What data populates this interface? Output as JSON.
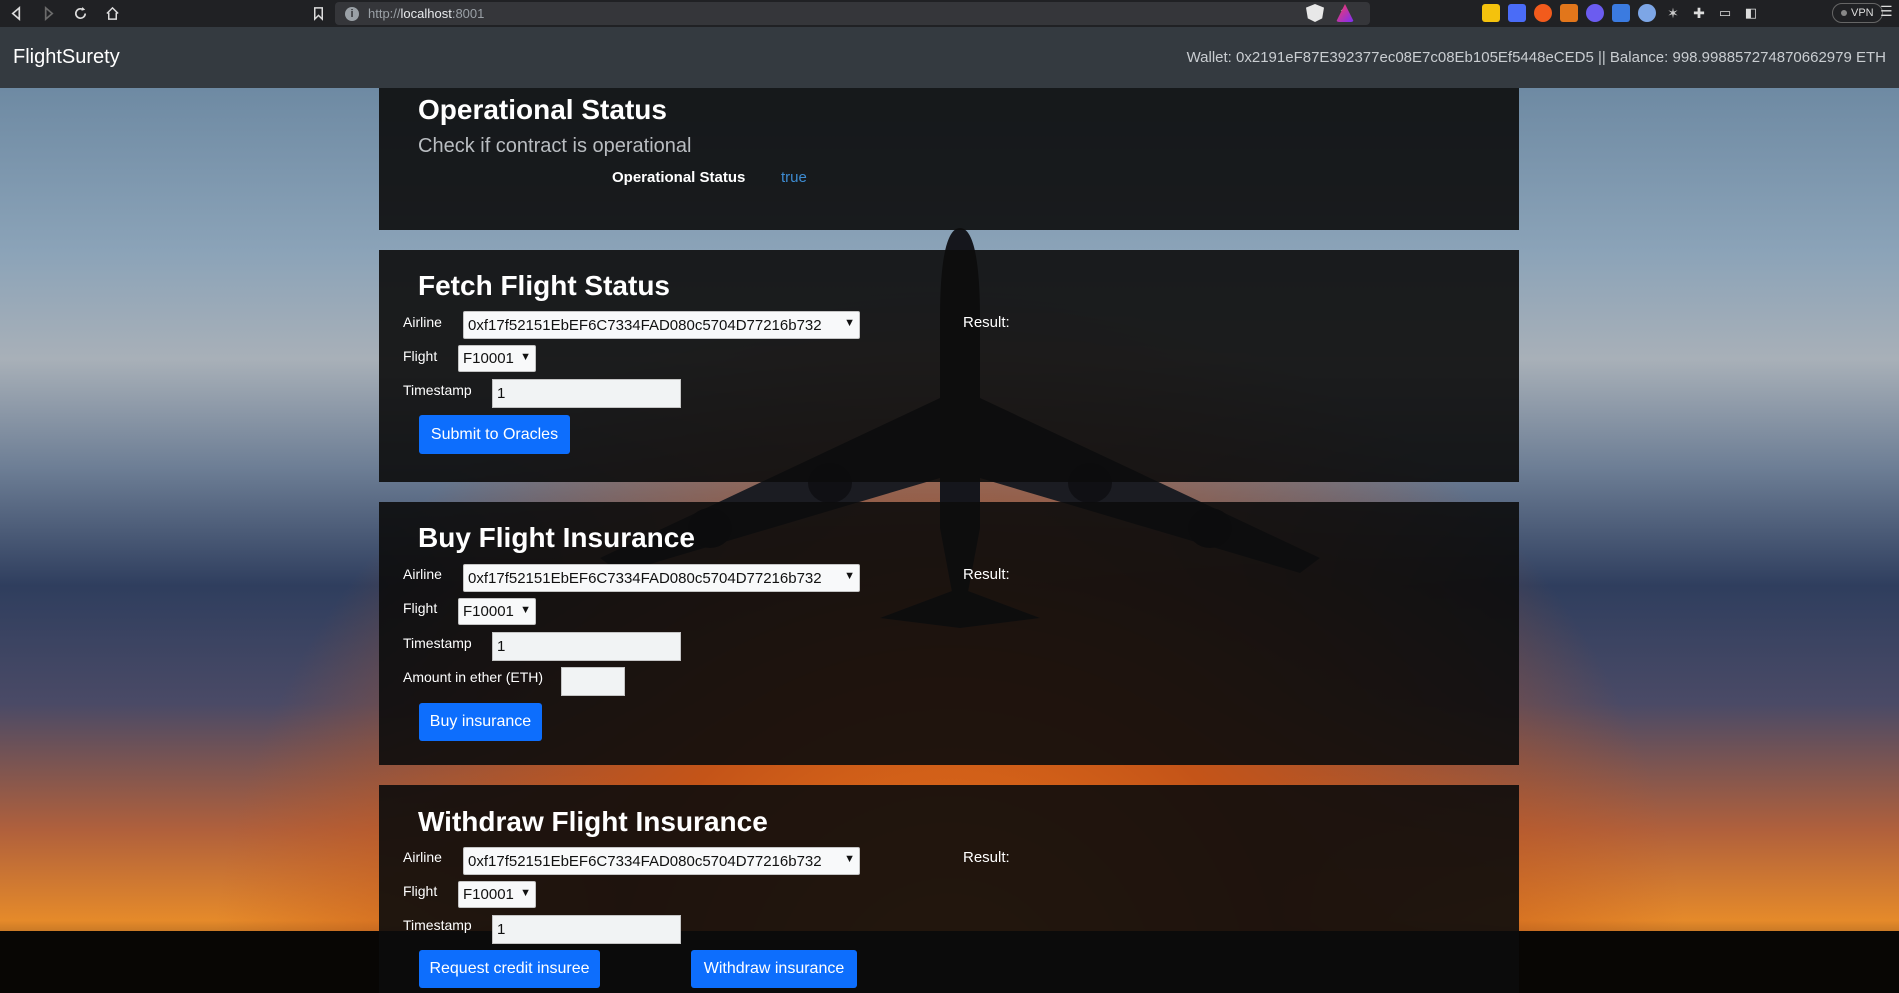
{
  "browser": {
    "url_scheme": "http://",
    "url_host": "localhost",
    "url_port": ":8001",
    "vpn_label": "VPN"
  },
  "navbar": {
    "brand": "FlightSurety",
    "wallet_text": "Wallet: 0x2191eF87E392377ec08E7c08Eb105Ef5448eCED5 || Balance: 998.998857274870662979 ETH"
  },
  "operational": {
    "title": "Operational Status",
    "subtitle": "Check if contract is operational",
    "status_label": "Operational Status",
    "status_value": "true"
  },
  "fetch": {
    "title": "Fetch Flight Status",
    "airline_label": "Airline",
    "airline_value": "0xf17f52151EbEF6C7334FAD080c5704D77216b732",
    "flight_label": "Flight",
    "flight_value": "F10001",
    "timestamp_label": "Timestamp",
    "timestamp_value": "1",
    "submit_label": "Submit to Oracles",
    "result_label": "Result:"
  },
  "buy": {
    "title": "Buy Flight Insurance",
    "airline_label": "Airline",
    "airline_value": "0xf17f52151EbEF6C7334FAD080c5704D77216b732",
    "flight_label": "Flight",
    "flight_value": "F10001",
    "timestamp_label": "Timestamp",
    "timestamp_value": "1",
    "amount_label": "Amount in ether (ETH)",
    "amount_value": "",
    "buy_label": "Buy insurance",
    "result_label": "Result:"
  },
  "withdraw": {
    "title": "Withdraw Flight Insurance",
    "airline_label": "Airline",
    "airline_value": "0xf17f52151EbEF6C7334FAD080c5704D77216b732",
    "flight_label": "Flight",
    "flight_value": "F10001",
    "timestamp_label": "Timestamp",
    "timestamp_value": "1",
    "request_label": "Request credit insuree",
    "withdraw_label": "Withdraw insurance",
    "result_label": "Result:"
  },
  "colors": {
    "navbar_bg": "#343a40",
    "button_primary": "#0d6efd",
    "status_value": "#3d8bd1",
    "panel_bg": "rgba(12,12,12,0.90)"
  }
}
